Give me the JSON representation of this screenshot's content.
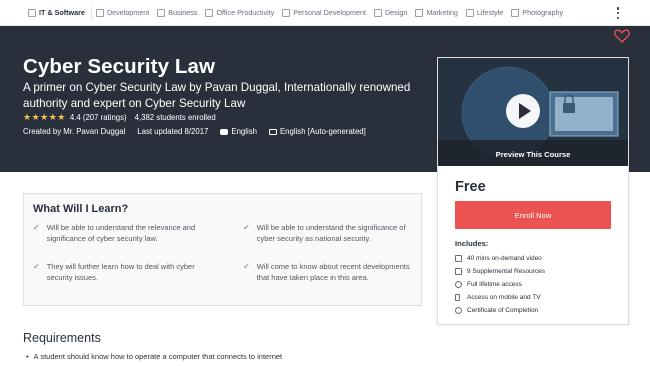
{
  "topnav": {
    "items": [
      {
        "label": "IT & Software",
        "icon": "monitor-icon"
      },
      {
        "label": "Development",
        "icon": "code-icon"
      },
      {
        "label": "Business",
        "icon": "chart-icon"
      },
      {
        "label": "Office Productivity",
        "icon": "briefcase-icon"
      },
      {
        "label": "Personal Development",
        "icon": "person-icon"
      },
      {
        "label": "Design",
        "icon": "pen-icon"
      },
      {
        "label": "Marketing",
        "icon": "megaphone-icon"
      },
      {
        "label": "Lifestyle",
        "icon": "lifestyle-icon"
      },
      {
        "label": "Photography",
        "icon": "camera-icon"
      }
    ]
  },
  "course": {
    "title": "Cyber Security Law",
    "subtitle": "A primer on Cyber Security Law by Pavan Duggal, Internationally renowned authority and expert on Cyber Security Law",
    "stars": "★★★★★",
    "rating_text": "4.4 (207 ratings)",
    "enrolled": "4,382 students enrolled",
    "created_by": "Created by Mr. Pavan Duggal",
    "last_updated": "Last updated 8/2017",
    "language": "English",
    "captions": "English [Auto-generated]"
  },
  "sidebar": {
    "preview_label": "Preview This Course",
    "price": "Free",
    "enroll_label": "Enroll Now",
    "includes_title": "Includes:",
    "includes": [
      {
        "label": "40 mins on-demand video",
        "icon": "video-icon"
      },
      {
        "label": "9 Supplemental Resources",
        "icon": "document-icon"
      },
      {
        "label": "Full lifetime access",
        "icon": "infinity-icon"
      },
      {
        "label": "Access on mobile and TV",
        "icon": "mobile-icon"
      },
      {
        "label": "Certificate of Completion",
        "icon": "certificate-icon"
      }
    ]
  },
  "learn": {
    "title": "What Will I Learn?",
    "items": [
      "Will be able to understand the relevance and significance of cyber security law.",
      "Will be able to understand the significance of cyber security as national security.",
      "They will further learn how to deal with cyber security issues.",
      "Will come to know about recent developments that have taken place in this area."
    ]
  },
  "requirements": {
    "title": "Requirements",
    "items": [
      "A student should know how to operate a computer that connects to internet"
    ]
  },
  "colors": {
    "header_bg": "#29303b",
    "accent": "#ec5252",
    "star": "#f4c150"
  }
}
